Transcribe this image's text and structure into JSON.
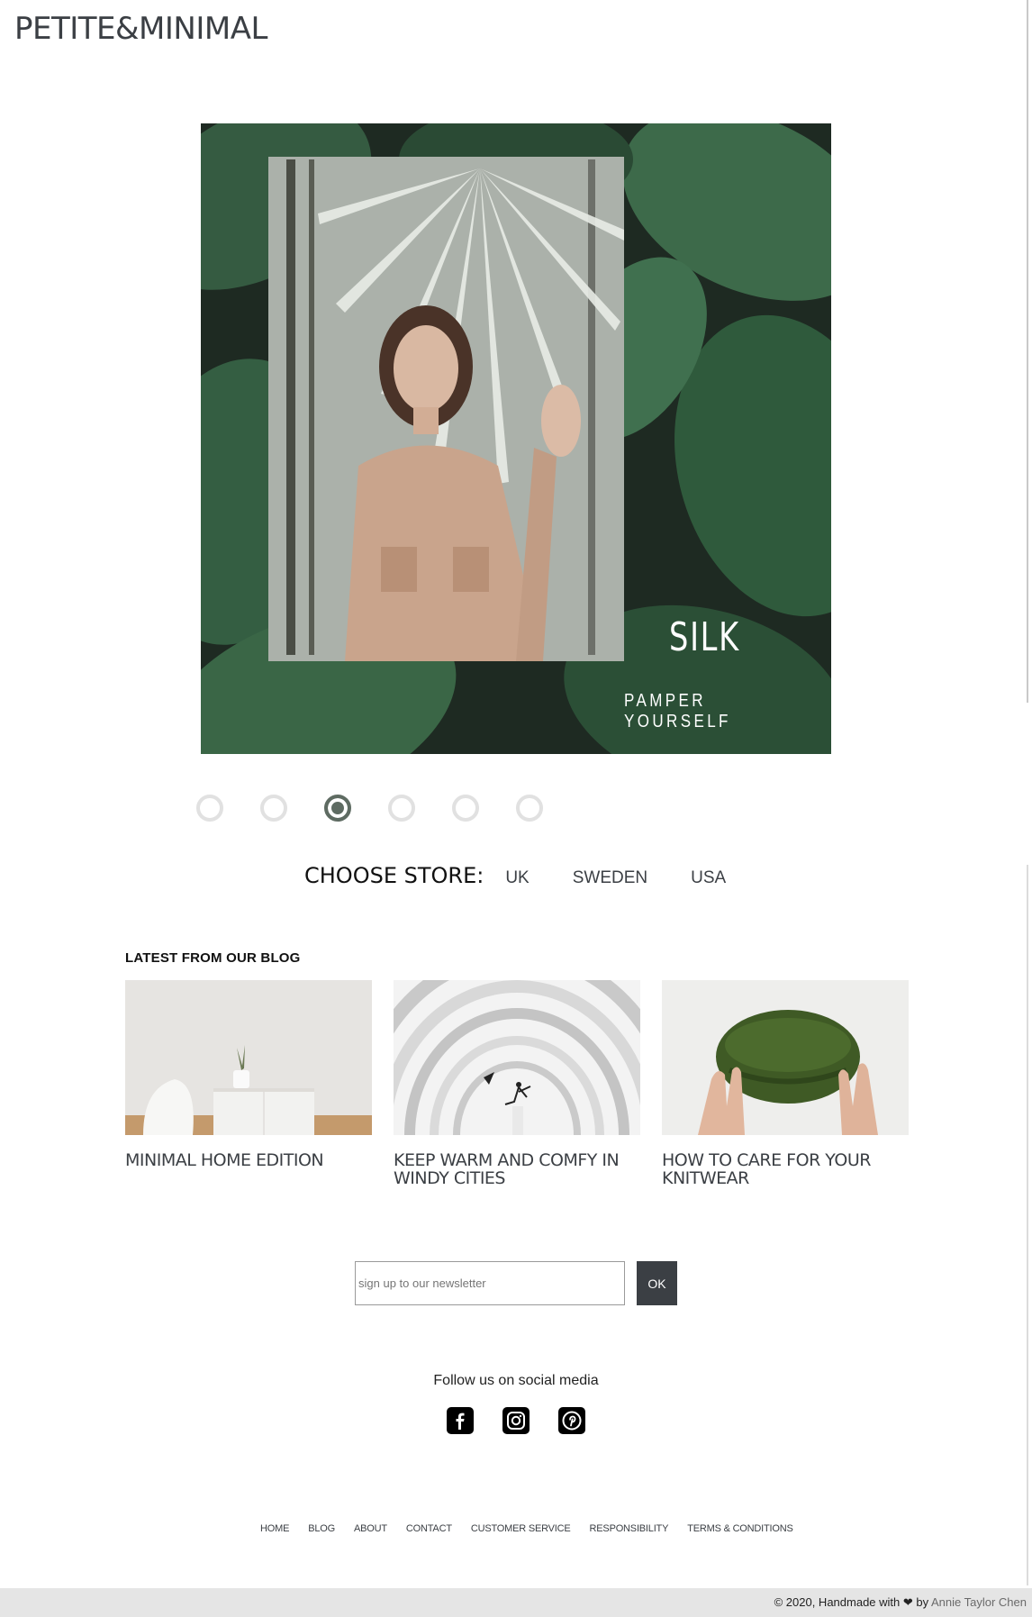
{
  "header": {
    "logo": "PETITE&MINIMAL"
  },
  "hero": {
    "title": "SILK",
    "subtitle": "PAMPER YOURSELF",
    "slides_count": 6,
    "active_slide": 3
  },
  "store": {
    "label": "CHOOSE STORE:",
    "options": [
      "UK",
      "SWEDEN",
      "USA"
    ]
  },
  "blog": {
    "heading": "LATEST FROM OUR BLOG",
    "posts": [
      {
        "title": "MINIMAL HOME EDITION"
      },
      {
        "title": "KEEP WARM AND COMFY IN WINDY CITIES"
      },
      {
        "title": "HOW TO CARE FOR YOUR KNITWEAR"
      }
    ]
  },
  "newsletter": {
    "placeholder": "sign up to our newsletter",
    "button": "OK"
  },
  "social": {
    "heading": "Follow us on social media",
    "icons": [
      "facebook-icon",
      "instagram-icon",
      "pinterest-icon"
    ]
  },
  "footer": {
    "links": [
      "HOME",
      "BLOG",
      "ABOUT",
      "CONTACT",
      "CUSTOMER SERVICE",
      "RESPONSIBILITY",
      "TERMS & CONDITIONS"
    ],
    "copyright": "© 2020, Handmade with ❤ by ",
    "author": "Annie Taylor Chen"
  },
  "colors": {
    "text": "#3b3f44",
    "accent": "#5e6b62",
    "button": "#3b3f44",
    "footer_bg": "#e5e5e5"
  }
}
